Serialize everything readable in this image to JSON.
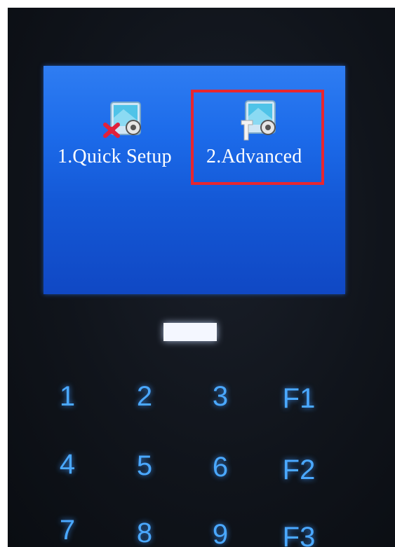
{
  "screen": {
    "menu_items": [
      {
        "label": "1.Quick Setup",
        "icon": "quick-setup-icon"
      },
      {
        "label": "2.Advanced",
        "icon": "advanced-settings-icon"
      }
    ],
    "selected_index": 1,
    "background_color": "#1c6bea",
    "selection_color": "#e8262f"
  },
  "keypad": {
    "rows": [
      [
        "1",
        "2",
        "3",
        "F1"
      ],
      [
        "4",
        "5",
        "6",
        "F2"
      ],
      [
        "7",
        "8",
        "9",
        "F3"
      ]
    ],
    "key_color": "#4aa8ff"
  }
}
